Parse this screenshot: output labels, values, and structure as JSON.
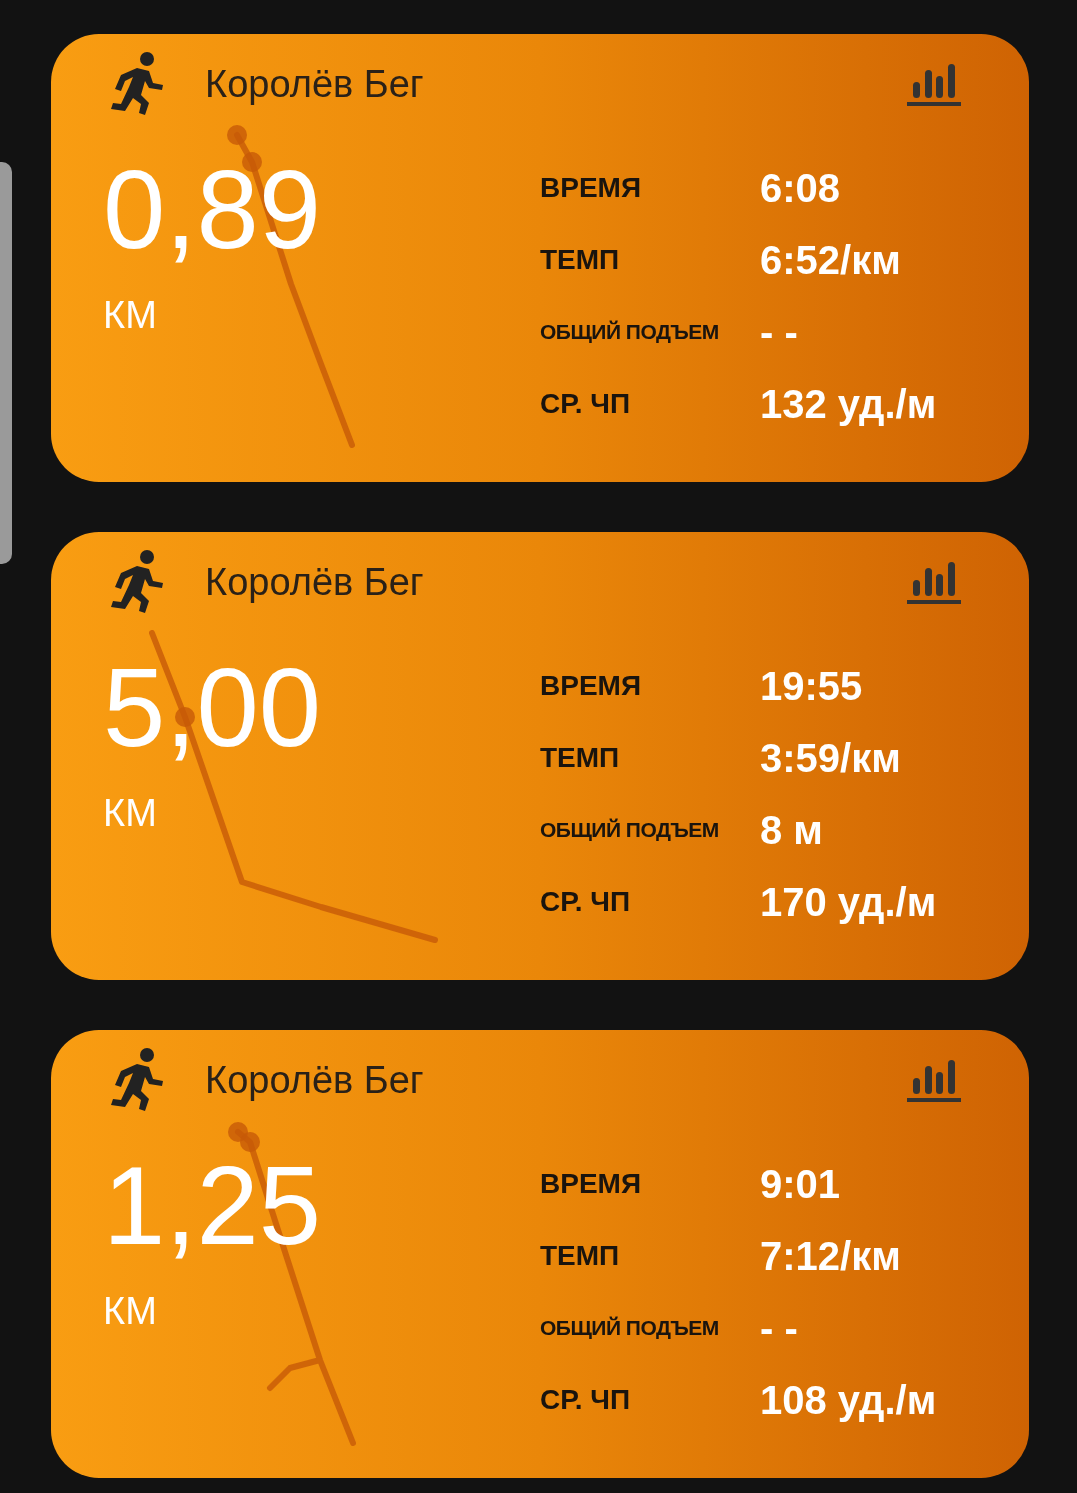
{
  "activities": [
    {
      "title": "Королёв Бег",
      "distance": "0,89",
      "unit": "КМ",
      "stats": [
        {
          "label": "ВРЕМЯ",
          "value": "6:08",
          "kind": "normal"
        },
        {
          "label": "ТЕМП",
          "value": "6:52/км",
          "kind": "normal"
        },
        {
          "label": "ОБЩИЙ ПОДЪЕМ",
          "value": "- -",
          "kind": "small"
        },
        {
          "label": "СР. ЧП",
          "value": "132 уд./м",
          "kind": "normal"
        }
      ]
    },
    {
      "title": "Королёв Бег",
      "distance": "5,00",
      "unit": "КМ",
      "stats": [
        {
          "label": "ВРЕМЯ",
          "value": "19:55",
          "kind": "normal"
        },
        {
          "label": "ТЕМП",
          "value": "3:59/км",
          "kind": "normal"
        },
        {
          "label": "ОБЩИЙ ПОДЪЕМ",
          "value": "8 м",
          "kind": "small"
        },
        {
          "label": "СР. ЧП",
          "value": "170 уд./м",
          "kind": "normal"
        }
      ]
    },
    {
      "title": "Королёв Бег",
      "distance": "1,25",
      "unit": "КМ",
      "stats": [
        {
          "label": "ВРЕМЯ",
          "value": "9:01",
          "kind": "normal"
        },
        {
          "label": "ТЕМП",
          "value": "7:12/км",
          "kind": "normal"
        },
        {
          "label": "ОБЩИЙ ПОДЪЕМ",
          "value": "- -",
          "kind": "small"
        },
        {
          "label": "СР. ЧП",
          "value": "108 уд./м",
          "kind": "normal"
        }
      ]
    }
  ]
}
